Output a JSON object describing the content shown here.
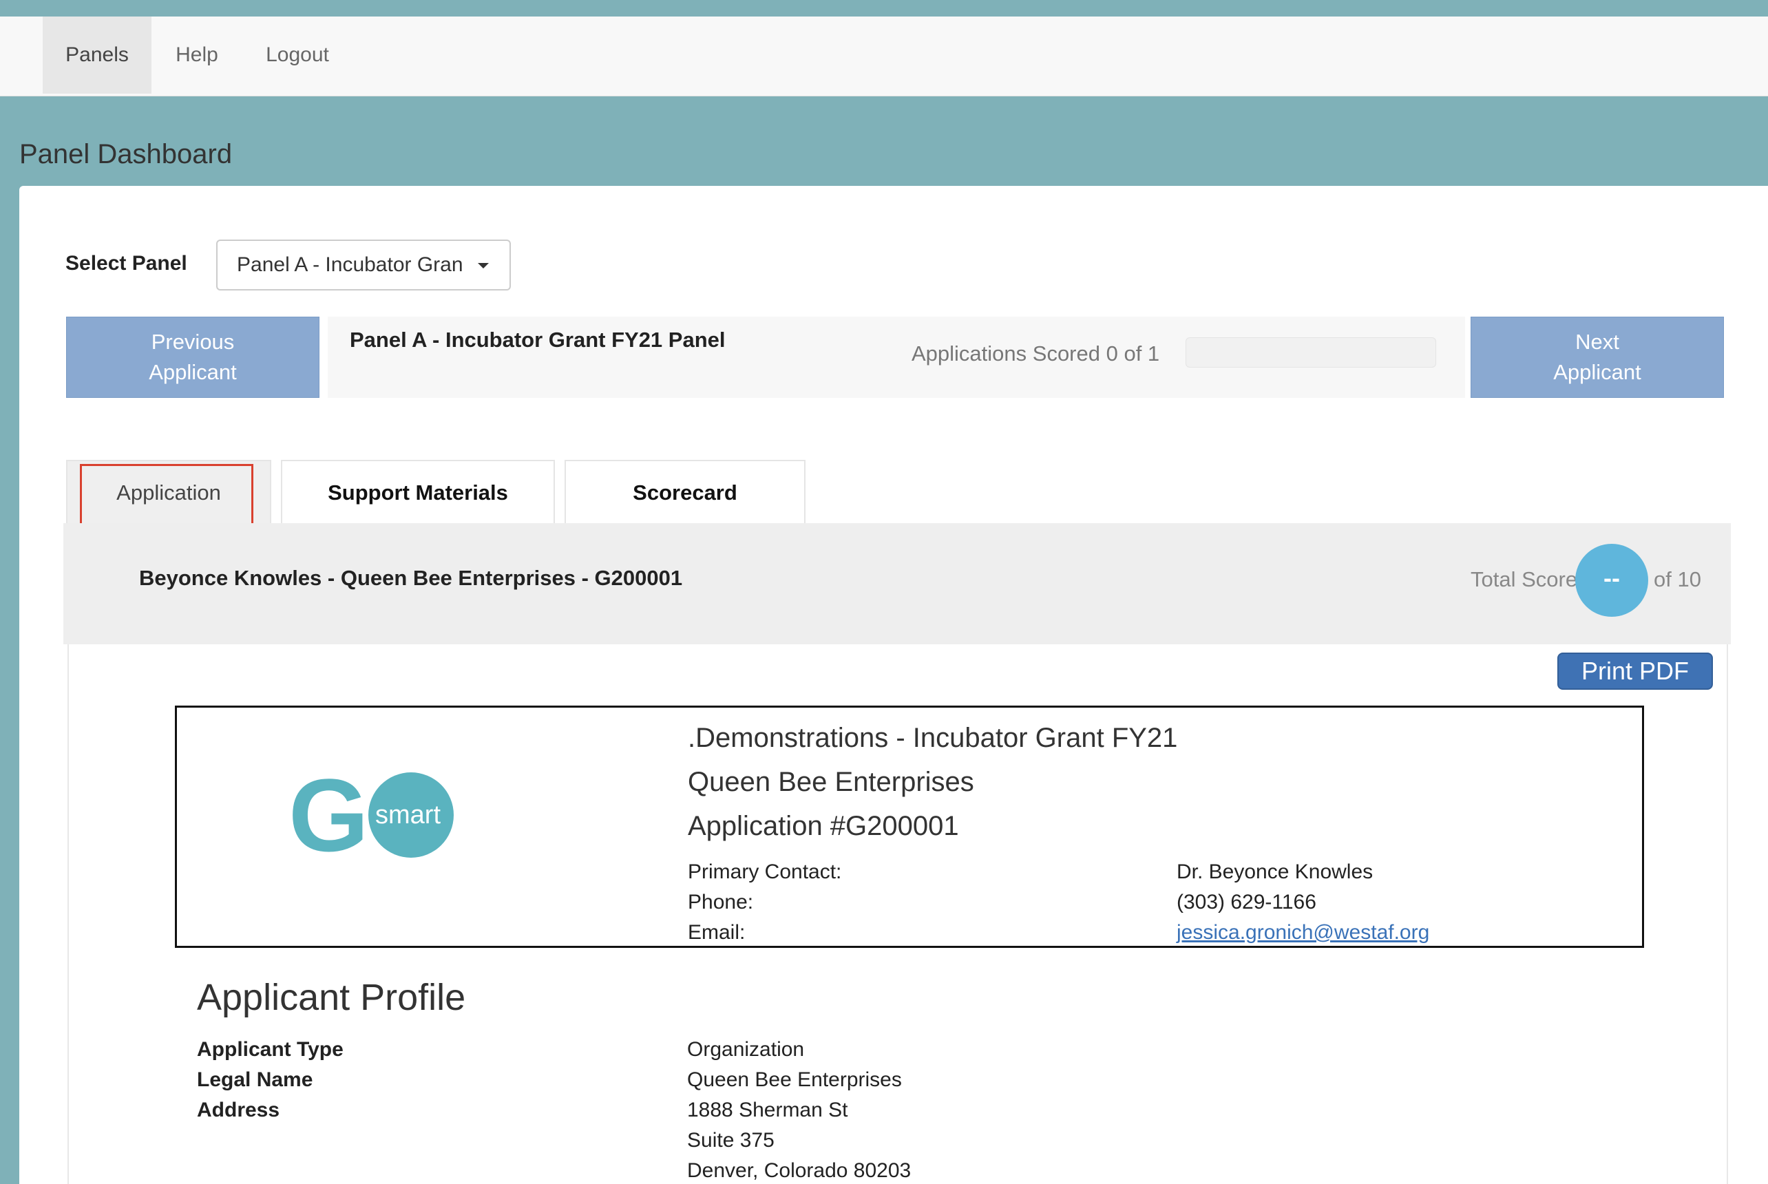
{
  "nav": {
    "items": [
      {
        "label": "Panels",
        "active": true
      },
      {
        "label": "Help",
        "active": false
      },
      {
        "label": "Logout",
        "active": false
      }
    ]
  },
  "page": {
    "title": "Panel Dashboard"
  },
  "select": {
    "label": "Select Panel",
    "value": "Panel A - Incubator Gran"
  },
  "buttons": {
    "previous_line1": "Previous",
    "previous_line2": "Applicant",
    "next_line1": "Next",
    "next_line2": "Applicant",
    "print_pdf": "Print PDF"
  },
  "panel": {
    "name": "Panel A - Incubator Grant FY21 Panel",
    "scored_text": "Applications Scored 0 of 1",
    "progress_fraction": 0
  },
  "tabs": [
    {
      "label": "Application",
      "active": true
    },
    {
      "label": "Support Materials",
      "active": false
    },
    {
      "label": "Scorecard",
      "active": false
    }
  ],
  "applicant": {
    "title": "Beyonce Knowles - Queen Bee Enterprises - G200001",
    "total_score_label": "Total Score",
    "score": "--",
    "of_label": "of 10"
  },
  "header": {
    "logo_letter": "G",
    "logo_word": "smart",
    "logo_color": "#5ab3bf",
    "line1": ".Demonstrations - Incubator Grant FY21",
    "line2": "Queen Bee Enterprises",
    "line3": "Application #G200001",
    "contact": [
      {
        "label": "Primary Contact:",
        "value": "Dr. Beyonce Knowles"
      },
      {
        "label": "Phone:",
        "value": "(303) 629-1166"
      },
      {
        "label": "Email:",
        "value": "jessica.gronich@westaf.org"
      }
    ]
  },
  "profile": {
    "title": "Applicant Profile",
    "rows": [
      {
        "label": "Applicant Type",
        "value": "Organization"
      },
      {
        "label": "Legal Name",
        "value": "Queen Bee Enterprises"
      },
      {
        "label": "Address",
        "value": "1888 Sherman St"
      }
    ],
    "address_extra": [
      "Suite 375",
      "Denver, Colorado 80203"
    ]
  }
}
